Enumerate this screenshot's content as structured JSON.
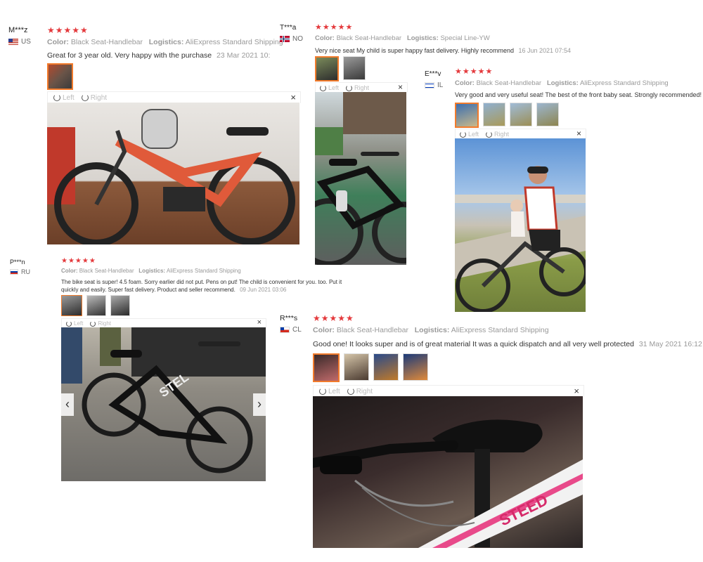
{
  "reviews": [
    {
      "user": "M***z",
      "country": "US",
      "stars": "★★★★★",
      "color_label": "Color:",
      "color_value": "Black Seat-Handlebar",
      "logistics_label": "Logistics:",
      "logistics_value": "AliExpress Standard Shipping",
      "text": "Great for 3 year old. Very happy with the purchase",
      "date": "23 Mar 2021 10:",
      "toolbar_left": "Left",
      "toolbar_right": "Right",
      "close": "×"
    },
    {
      "user": "T***a",
      "country": "NO",
      "stars": "★★★★★",
      "color_label": "Color:",
      "color_value": "Black Seat-Handlebar",
      "logistics_label": "Logistics:",
      "logistics_value": "Special Line-YW",
      "text": "Very nice seat My child is super happy fast delivery. Highly recommend",
      "date": "16 Jun 2021 07:54",
      "toolbar_left": "Left",
      "toolbar_right": "Right",
      "close": "×"
    },
    {
      "user": "E***v",
      "country": "IL",
      "stars": "★★★★★",
      "color_label": "Color:",
      "color_value": "Black Seat-Handlebar",
      "logistics_label": "Logistics:",
      "logistics_value": "AliExpress Standard Shipping",
      "text": "Very good and very useful seat! The best of the front baby seat. Strongly recommended!",
      "toolbar_left": "Left",
      "toolbar_right": "Right",
      "close": "×"
    },
    {
      "user": "P***n",
      "country": "RU",
      "stars": "★★★★★",
      "color_label": "Color:",
      "color_value": "Black Seat-Handlebar",
      "logistics_label": "Logistics:",
      "logistics_value": "AliExpress Standard Shipping",
      "text_line1": "The bike seat is super! 4.5 foam. Sorry earlier did not put. Pens on put! The child is convenient for you. too. Put it",
      "text_line2": "quickly and easily. Super fast delivery. Product and seller recommend.",
      "date": "09 Jun 2021 03:06",
      "toolbar_left": "Left",
      "toolbar_right": "Right",
      "close": "×",
      "prev": "‹",
      "next": "›"
    },
    {
      "user": "R***s",
      "country": "CL",
      "stars": "★★★★★",
      "color_label": "Color:",
      "color_value": "Black Seat-Handlebar",
      "logistics_label": "Logistics:",
      "logistics_value": "AliExpress Standard Shipping",
      "text": "Good one! It looks super and is of great material It was a quick dispatch and all very well protected",
      "date": "31 May 2021 16:12",
      "toolbar_left": "Left",
      "toolbar_right": "Right",
      "close": "×"
    }
  ],
  "colors": {
    "star": "#e4393c",
    "active_thumb_border": "#f27b2c"
  },
  "icons": [
    "rotate-left-icon",
    "rotate-right-icon",
    "close-icon",
    "flag-icon",
    "chevron-left-icon",
    "chevron-right-icon"
  ]
}
